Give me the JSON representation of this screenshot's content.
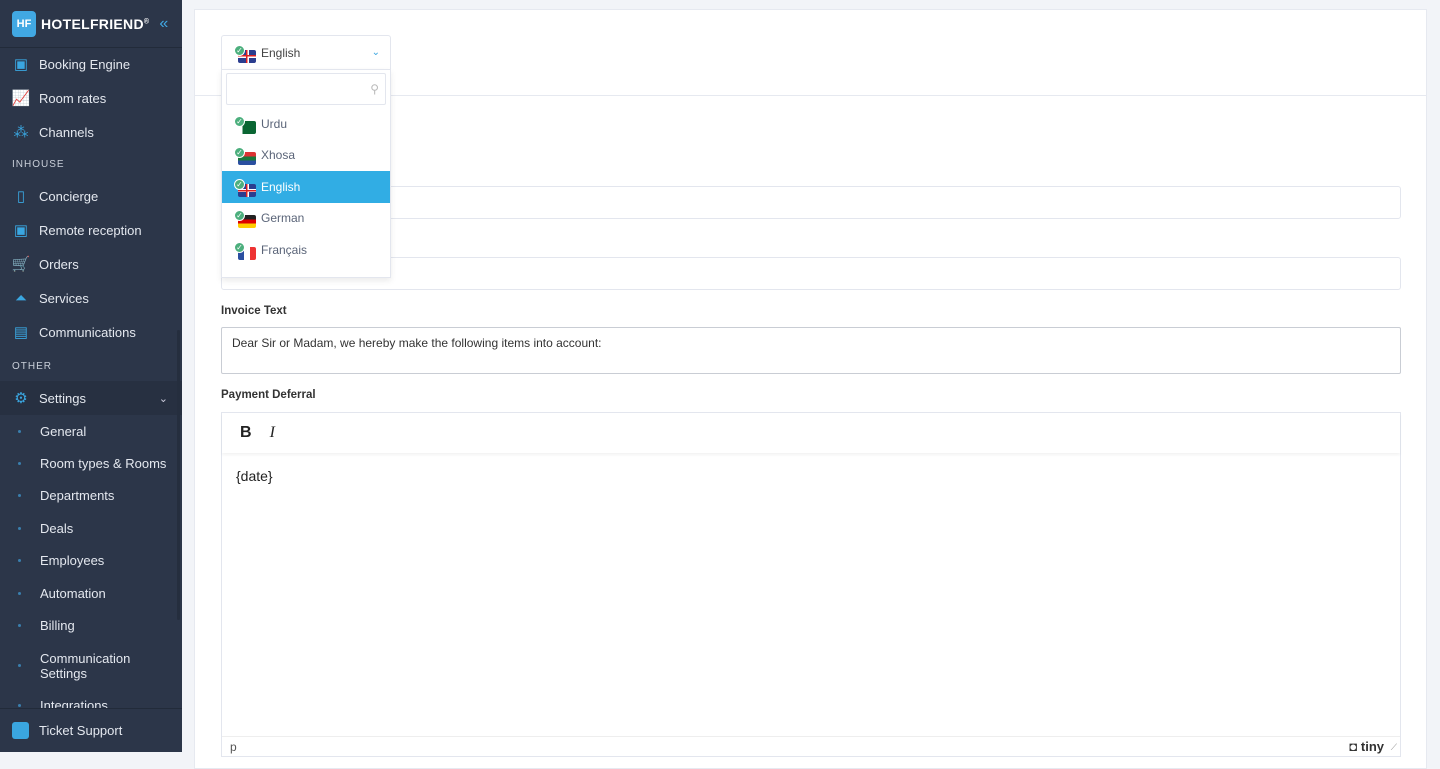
{
  "app": {
    "brand": "HOTELFRIEND",
    "trademark": "®"
  },
  "sidebar": {
    "items_top": [
      {
        "label": "Booking Engine",
        "icon": "booking-engine-icon"
      },
      {
        "label": "Room rates",
        "icon": "chart-icon"
      },
      {
        "label": "Channels",
        "icon": "network-icon"
      }
    ],
    "section_inhouse": "INHOUSE",
    "items_inhouse": [
      {
        "label": "Concierge",
        "icon": "mobile-icon"
      },
      {
        "label": "Remote reception",
        "icon": "reception-icon"
      },
      {
        "label": "Orders",
        "icon": "cart-icon"
      },
      {
        "label": "Services",
        "icon": "bell-icon"
      },
      {
        "label": "Communications",
        "icon": "chat-icon"
      }
    ],
    "section_other": "OTHER",
    "settings": {
      "label": "Settings",
      "icon": "gear-icon"
    },
    "settings_sub": [
      "General",
      "Room types & Rooms",
      "Departments",
      "Deals",
      "Employees",
      "Automation",
      "Billing",
      "Communication Settings",
      "Integrations"
    ],
    "ticket_support": "Ticket Support"
  },
  "language_select": {
    "selected": "English",
    "search_placeholder": "",
    "options": [
      {
        "label": "Urdu",
        "flag": "pk"
      },
      {
        "label": "Xhosa",
        "flag": "za"
      },
      {
        "label": "English",
        "flag": "uk",
        "selected": true
      },
      {
        "label": "German",
        "flag": "de"
      },
      {
        "label": "Français",
        "flag": "fr"
      }
    ]
  },
  "form": {
    "invoice_text_label": "Invoice Text",
    "invoice_text_value": "Dear Sir or Madam, we hereby make the following items into account:",
    "payment_deferral_label": "Payment Deferral",
    "editor": {
      "bold": "B",
      "italic": "I",
      "content": "{date}",
      "status_path": "p",
      "brand": "tiny"
    }
  }
}
